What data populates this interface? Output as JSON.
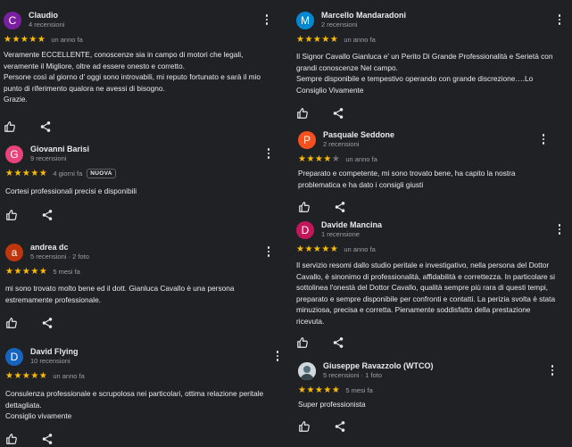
{
  "reviews": [
    {
      "name": "Claudio",
      "meta": "4 recensioni",
      "initial": "C",
      "avatar_color": "#7b1fa2",
      "stars": 5,
      "date": "un anno fa",
      "badge": "",
      "text": "Veramente ECCELLENTE, conoscenze sia in campo di motori che legali, veramente il Migliore, oltre ad essere onesto e corretto.\nPersone così al giorno d' oggi sono introvabili, mi reputo fortunato e sarà il mio punto di riferimento qualora ne avessi di bisogno.\nGrazie."
    },
    {
      "name": "Giovanni Barisi",
      "meta": "9 recensioni",
      "initial": "G",
      "avatar_color": "#e8437a",
      "stars": 5,
      "date": "4 giorni fa",
      "badge": "NUOVA",
      "text": "Cortesi professionali precisi e disponibili"
    },
    {
      "name": "andrea dc",
      "meta": "5 recensioni · 2 foto",
      "initial": "a",
      "avatar_color": "#bf360c",
      "stars": 5,
      "date": "5 mesi fa",
      "badge": "",
      "text": "mi sono trovato molto bene ed il dott. Gianluca Cavallo è una persona estremamente professionale."
    },
    {
      "name": "David Flying",
      "meta": "10 recensioni",
      "initial": "D",
      "avatar_color": "#1565c0",
      "stars": 5,
      "date": "un anno fa",
      "badge": "",
      "text": "Consulenza professionale e scrupolosa nei particolari, ottima relazione peritale dettagliata.\nConsiglio vivamente"
    },
    {
      "name": "Marcello Mandaradoni",
      "meta": "2 recensioni",
      "initial": "M",
      "avatar_color": "#0288d1",
      "stars": 5,
      "date": "un anno fa",
      "badge": "",
      "text": "Il Signor Cavallo Gianluca e' un Perito Di Grande Professionalità e Serietà con grandi conoscenze Nel campo.\nSempre disponibile e tempestivo operando con grande discrezione….Lo Consiglio Vivamente"
    },
    {
      "name": "Pasquale Seddone",
      "meta": "2 recensioni",
      "initial": "P",
      "avatar_color": "#f4511e",
      "stars": 4,
      "date": "un anno fa",
      "badge": "",
      "text": "Preparato e competente, mi sono trovato bene, ha capito la nostra problematica e ha dato i consigli giusti"
    },
    {
      "name": "Davide Mancina",
      "meta": "1 recensione",
      "initial": "D",
      "avatar_color": "#c2185b",
      "stars": 5,
      "date": "un anno fa",
      "badge": "",
      "text": "Il servizio resomi dallo studio peritale e investigativo, nella persona del Dottor Cavallo, è sinonimo di professionalità, affidabilità e correttezza. In particolare si sottolinea l'onestà del Dottor Cavallo, qualità sempre più rara di questi tempi, preparato e sempre disponibile per confronti e contatti. La perizia svolta è stata minuziosa, precisa e corretta. Pienamente soddisfatto della prestazione ricevuta."
    },
    {
      "name": "Giuseppe Ravazzolo (WTCO)",
      "meta": "5 recensioni · 1 foto",
      "initial": "",
      "avatar_color": "#bdbdbd",
      "stars": 5,
      "date": "5 mesi fa",
      "badge": "",
      "text": "Super professionista"
    }
  ]
}
